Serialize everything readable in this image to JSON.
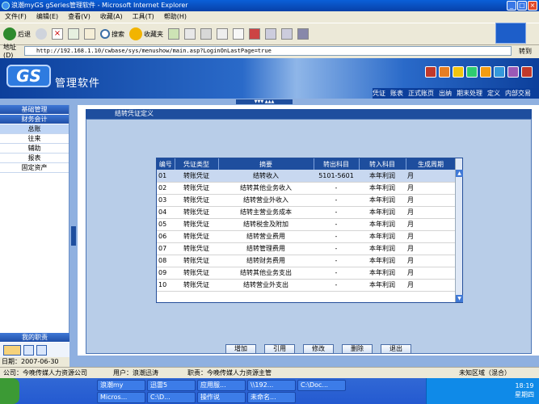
{
  "window": {
    "title": "浪潮myGS gSeries管理软件 - Microsoft Internet Explorer",
    "min": "_",
    "max": "□",
    "close": "×"
  },
  "menubar": [
    "文件(F)",
    "编辑(E)",
    "查看(V)",
    "收藏(A)",
    "工具(T)",
    "帮助(H)"
  ],
  "toolbar": {
    "back": "后退",
    "search": "搜索",
    "favorites": "收藏夹"
  },
  "address": {
    "label": "地址(D)",
    "url": "http://192.168.1.10/cwbase/sys/menushow/main.asp?LoginOnLastPage=true",
    "go": "转到"
  },
  "app": {
    "logo": "GS",
    "name": "管理软件"
  },
  "nav_tabs": [
    "凭证",
    "账表",
    "正式账页",
    "出纳",
    "期末处理",
    "定义",
    "内部交易"
  ],
  "sidebar": {
    "sections": [
      "基础管理",
      "财务会计"
    ],
    "items": [
      "总账",
      "往来",
      "辅助",
      "报表",
      "固定资产"
    ],
    "active": "总账",
    "bottom_section": "我的职责",
    "date_label": "日期：",
    "date_value": "2007-06-30"
  },
  "panel": {
    "title": "结转凭证定义"
  },
  "table": {
    "headers": [
      "编号",
      "凭证类型",
      "摘要",
      "转出科目",
      "转入科目",
      "生成周期"
    ],
    "rows": [
      [
        "01",
        "转账凭证",
        "结转收入",
        "5101-5601",
        "本年利润",
        "月"
      ],
      [
        "02",
        "转账凭证",
        "结转其他业务收入",
        "-",
        "本年利润",
        "月"
      ],
      [
        "03",
        "转账凭证",
        "结转营业外收入",
        "-",
        "本年利润",
        "月"
      ],
      [
        "04",
        "转账凭证",
        "结转主营业务成本",
        "-",
        "本年利润",
        "月"
      ],
      [
        "05",
        "转账凭证",
        "结转税金及附加",
        "-",
        "本年利润",
        "月"
      ],
      [
        "06",
        "转账凭证",
        "结转营业费用",
        "-",
        "本年利润",
        "月"
      ],
      [
        "07",
        "转账凭证",
        "结转管理费用",
        "-",
        "本年利润",
        "月"
      ],
      [
        "08",
        "转账凭证",
        "结转财务费用",
        "-",
        "本年利润",
        "月"
      ],
      [
        "09",
        "转账凭证",
        "结转其他业务支出",
        "-",
        "本年利润",
        "月"
      ],
      [
        "10",
        "转账凭证",
        "结转营业外支出",
        "-",
        "本年利润",
        "月"
      ]
    ]
  },
  "buttons": [
    "增加",
    "引用",
    "修改",
    "删除",
    "退出"
  ],
  "status": {
    "company": "公司：今晚传媒人力资源公司",
    "user": "用户：浪潮迅涛",
    "role": "职责：今晚传媒人力资源主管",
    "zone": "未知区域（混合）"
  },
  "taskbar": {
    "tasks": [
      "浪潮my",
      "迅雷5",
      "应用服...",
      "\\\\192...",
      "C:\\Doc...",
      "Micros...",
      "C:\\D...",
      "操作说",
      "未命名..."
    ],
    "time": "18:19",
    "day": "星期四"
  }
}
